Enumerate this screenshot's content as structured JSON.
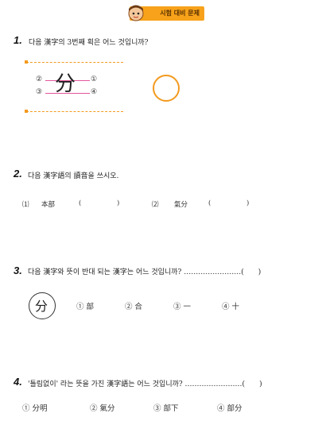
{
  "header": {
    "banner_label": "시험 대비 문제"
  },
  "questions": [
    {
      "number": "1.",
      "text": "다음 漢字의 3번째 획은 어느 것입니까?",
      "character": "分",
      "stroke_labels": [
        "②",
        "③",
        "①",
        "④"
      ]
    },
    {
      "number": "2.",
      "text": "다음 漢字語의 讀音을 쓰시오.",
      "items": [
        {
          "marker": "⑴",
          "word": "本部",
          "paren_open": "(",
          "paren_close": ")"
        },
        {
          "marker": "⑵",
          "word": "氣分",
          "paren_open": "(",
          "paren_close": ")"
        }
      ]
    },
    {
      "number": "3.",
      "text": "다음 漢字와 뜻이 반대 되는 漢字는 어느 것입니까? ……………………(　　)",
      "target": "分",
      "options": [
        "① 部",
        "② 合",
        "③ 一",
        "④ 十"
      ]
    },
    {
      "number": "4.",
      "text": "'틀림없이' 라는 뜻을 가진 漢字語는 어느 것입니까? ……………………(　　)",
      "options": [
        "① 分明",
        "② 氣分",
        "③ 部下",
        "④ 部分"
      ]
    }
  ],
  "colors": {
    "accent": "#f39a1e",
    "stroke_guides": "#e4569a"
  }
}
